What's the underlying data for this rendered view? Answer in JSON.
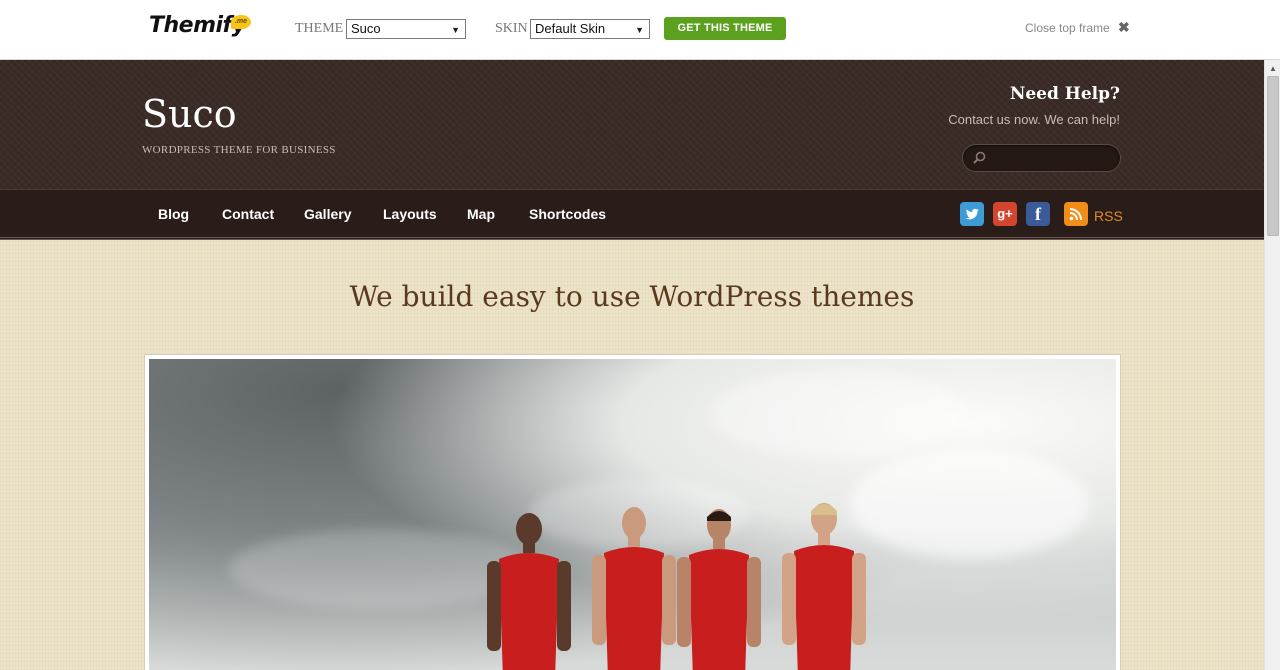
{
  "topbar": {
    "logo_text": "Themify",
    "logo_badge": ".me",
    "theme_label": "THEME",
    "theme_value": "Suco",
    "skin_label": "SKIN",
    "skin_value": "Default Skin",
    "cta_label": "GET THIS THEME",
    "close_label": "Close top frame",
    "cta_color": "#5ca11e"
  },
  "header": {
    "site_title": "Suco",
    "tagline": "WORDPRESS THEME FOR BUSINESS",
    "help_title": "Need Help?",
    "help_subtitle": "Contact us now. We can help!",
    "search_placeholder": ""
  },
  "nav": {
    "items": [
      {
        "label": "Blog"
      },
      {
        "label": "Contact"
      },
      {
        "label": "Gallery"
      },
      {
        "label": "Layouts"
      },
      {
        "label": "Map"
      },
      {
        "label": "Shortcodes"
      }
    ],
    "social": [
      "twitter-icon",
      "google-plus-icon",
      "facebook-icon",
      "rss-icon"
    ],
    "rss_label": "RSS"
  },
  "main": {
    "headline": "We build easy to use WordPress themes"
  }
}
